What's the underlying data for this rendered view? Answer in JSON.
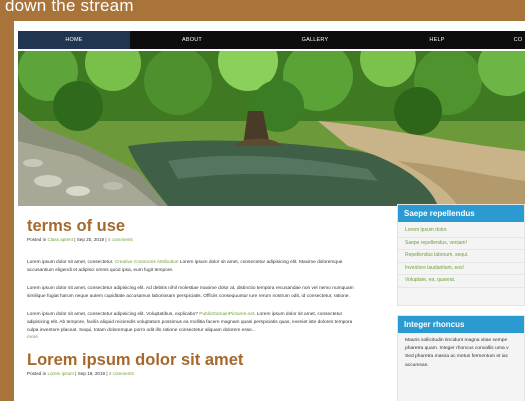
{
  "site": {
    "title": "down the stream"
  },
  "nav": {
    "items": [
      "HOME",
      "ABOUT",
      "GALLERY",
      "HELP",
      "CO"
    ],
    "active": "HOME"
  },
  "posts": [
    {
      "title": "terms of use",
      "meta": {
        "prefix": "Posted in",
        "category": "Class aptent",
        "date": "| Sep 20, 2019 |",
        "comments": "4 comments"
      },
      "paragraphs": [
        {
          "before": "Lorem ipsum dolor sit amet, consectetur.",
          "link": "Creative Commons Attribution",
          "after": "Lorem ipsum dolor sit amet, consectetur adipisicing elit. Maxime doloremque accusantium eligendi et adipisci omnis quod ipsa, eum fugit tempore."
        },
        {
          "text": "Lorem ipsum dolor sit amet, consectetur adipisicing elit. Ad debitis nihil molestiae maxime dolor at, distinctio tempora recusandae non vel nemo numquam similique fugiat harum neque autem cupiditate accusamus laboriosam perspiciatis. Officiis consequuntur iure rerum nostrum odit, id consectetur, ratione."
        },
        {
          "before": "Lorem ipsum dolor sit amet, consectetur adipisicing elit. Voluptatibus, explicabo?",
          "link": "PublicDomainPictures.net",
          "after": ". Lorem ipsum dolor sit amet, consectetur adipisicing elit. Ab tempore, facilis aliquid reiciendis voluptatum possimus ea mollitia facere magnam quasi perspiciatis quas, eveniet iste dolores tempora culpa inventore placeat. Sequi, totam doloremque porro odit illo ratione consectetur aliquam dolorem esse...",
          "more": "more"
        }
      ]
    },
    {
      "title": "Lorem ipsum dolor sit amet",
      "meta": {
        "prefix": "Posted in",
        "category": "Lorem ipsum",
        "date": "| Sep 19, 2019 |",
        "comments": "2 comments"
      }
    }
  ],
  "sidebar": {
    "widget1": {
      "title": "Saepe repellendus",
      "links": [
        "Lorem ipsum dolor.",
        "Saepe repellendus, veniam!",
        "Repellendus laborum, sequi.",
        "Inventore laudantium, eos!",
        "Voluptate, ea, quaerat."
      ]
    },
    "widget2": {
      "title": "Integer rhoncus",
      "lines": [
        "Mauris sollicitudin tincidunt magna vitae sempe",
        "pharetra quam. Integer rhoncus convallis urna v",
        "Sed pharetra massa ac metus fermentum et iac",
        "accumsan."
      ]
    }
  },
  "colors": {
    "background": "#a9743a",
    "nav": "#0d0d0d",
    "nav_active": "#1f3550",
    "title": "#a5692c",
    "link": "#6fa03a",
    "widget_header": "#2a9ad0"
  }
}
